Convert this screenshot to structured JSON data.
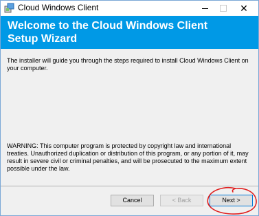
{
  "window": {
    "title": "Cloud Windows Client",
    "close_glyph": "✕"
  },
  "banner": {
    "title": "Welcome to the Cloud Windows Client Setup Wizard"
  },
  "content": {
    "intro": "The installer will guide you through the steps required to install Cloud Windows Client on your computer.",
    "warning": "WARNING: This computer program is protected by copyright law and international treaties. Unauthorized duplication or distribution of this program, or any portion of it, may result in severe civil or criminal penalties, and will be prosecuted to the maximum extent possible under the law."
  },
  "buttons": {
    "cancel": "Cancel",
    "back": "< Back",
    "next": "Next >"
  },
  "colors": {
    "banner": "#0099e6",
    "annotation": "#e02020",
    "focus_border": "#0078d7"
  },
  "icons": {
    "app": "installer-icon",
    "min": "minimize-icon",
    "max": "maximize-icon",
    "close": "close-icon"
  }
}
